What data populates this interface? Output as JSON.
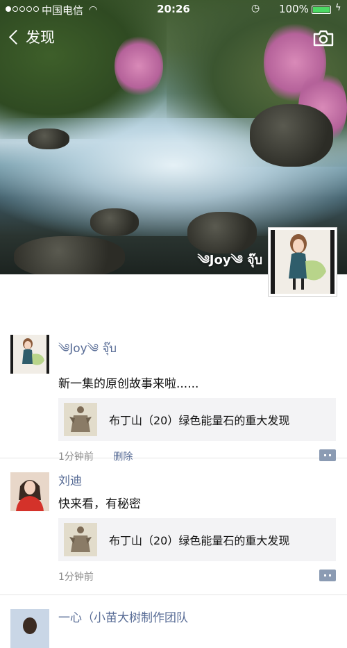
{
  "status_bar": {
    "carrier": "中国电信",
    "time": "20:26",
    "battery": "100%"
  },
  "nav": {
    "back_label": "发现"
  },
  "profile": {
    "name": "༄Joy༄ จุ๊บ"
  },
  "posts": [
    {
      "author": "༄Joy༄ จุ๊บ",
      "text": "新一集的原创故事来啦......",
      "link_title": "布丁山（20）绿色能量石的重大发现",
      "time": "1分钟前",
      "delete_label": "删除"
    },
    {
      "author": "刘迪",
      "text": "快来看，有秘密",
      "link_title": "布丁山（20）绿色能量石的重大发现",
      "time": "1分钟前"
    },
    {
      "author": "一心（小苗大树制作团队"
    }
  ],
  "colors": {
    "link_blue": "#576b95",
    "card_bg": "#f3f3f5",
    "comment_icon": "#8b9bb3"
  }
}
